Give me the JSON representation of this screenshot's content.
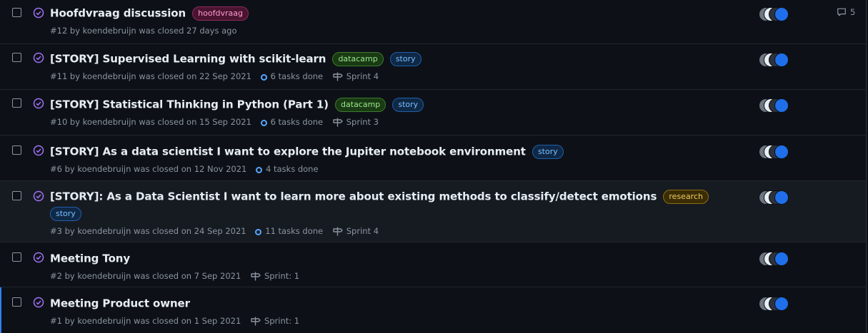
{
  "issues": [
    {
      "title": "Hoofdvraag discussion",
      "labels": [
        {
          "text": "hoofdvraag",
          "kind": "hoofdvraag"
        }
      ],
      "meta": "#12 by koendebruijn was closed 27 days ago",
      "tasks": "",
      "milestone": "",
      "comments": "5"
    },
    {
      "title": "[STORY] Supervised Learning with scikit-learn",
      "labels": [
        {
          "text": "datacamp",
          "kind": "datacamp"
        },
        {
          "text": "story",
          "kind": "story"
        }
      ],
      "meta": "#11 by koendebruijn was closed on 22 Sep 2021",
      "tasks": "6 tasks done",
      "milestone": "Sprint 4"
    },
    {
      "title": "[STORY] Statistical Thinking in Python (Part 1)",
      "labels": [
        {
          "text": "datacamp",
          "kind": "datacamp"
        },
        {
          "text": "story",
          "kind": "story"
        }
      ],
      "meta": "#10 by koendebruijn was closed on 15 Sep 2021",
      "tasks": "6 tasks done",
      "milestone": "Sprint 3"
    },
    {
      "title": "[STORY] As a data scientist I want to explore the Jupiter notebook environment",
      "labels": [
        {
          "text": "story",
          "kind": "story"
        }
      ],
      "meta": "#6 by koendebruijn was closed on 12 Nov 2021",
      "tasks": "4 tasks done",
      "milestone": ""
    },
    {
      "title": "[STORY]: As a Data Scientist I want to learn more about existing methods to classify/detect emotions",
      "labels": [
        {
          "text": "research",
          "kind": "research"
        },
        {
          "text": "story",
          "kind": "story"
        }
      ],
      "meta": "#3 by koendebruijn was closed on 24 Sep 2021",
      "tasks": "11 tasks done",
      "milestone": "Sprint 4"
    },
    {
      "title": "Meeting Tony",
      "labels": [],
      "meta": "#2 by koendebruijn was closed on 7 Sep 2021",
      "tasks": "",
      "milestone": "Sprint: 1"
    },
    {
      "title": "Meeting Product owner",
      "labels": [],
      "meta": "#1 by koendebruijn was closed on 1 Sep 2021",
      "tasks": "",
      "milestone": "Sprint: 1"
    }
  ]
}
